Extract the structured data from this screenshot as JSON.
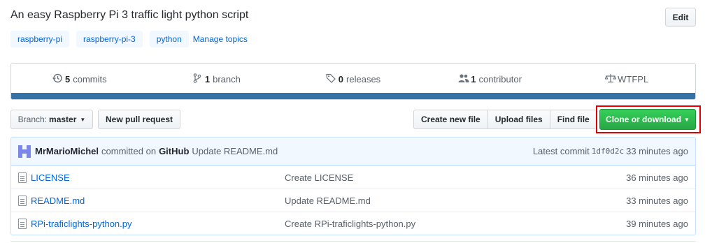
{
  "repo": {
    "description": "An easy Raspberry Pi 3 traffic light python script",
    "edit_label": "Edit",
    "topics": [
      "raspberry-pi",
      "raspberry-pi-3",
      "python"
    ],
    "manage_topics_label": "Manage topics"
  },
  "summary": {
    "commits": {
      "count": "5",
      "label": "commits",
      "icon": "history-icon"
    },
    "branches": {
      "count": "1",
      "label": "branch",
      "icon": "git-branch-icon"
    },
    "releases": {
      "count": "0",
      "label": "releases",
      "icon": "tag-icon"
    },
    "contributors": {
      "count": "1",
      "label": "contributor",
      "icon": "people-icon"
    },
    "license": {
      "label": "WTFPL",
      "icon": "law-icon"
    },
    "language_bar_color": "#3572a5"
  },
  "toolbar": {
    "branch_prefix": "Branch:",
    "branch_name": "master",
    "new_pr_label": "New pull request",
    "create_file_label": "Create new file",
    "upload_files_label": "Upload files",
    "find_file_label": "Find file",
    "clone_label": "Clone or download",
    "clone_highlight_color": "#e00000"
  },
  "commit": {
    "author": "MrMarioMichel",
    "action_text": "committed on",
    "org": "GitHub",
    "message": "Update README.md",
    "latest_label": "Latest commit",
    "sha": "1df0d2c",
    "age": "33 minutes ago"
  },
  "files": [
    {
      "name": "LICENSE",
      "message": "Create LICENSE",
      "age": "36 minutes ago"
    },
    {
      "name": "README.md",
      "message": "Update README.md",
      "age": "33 minutes ago"
    },
    {
      "name": "RPi-traficlights-python.py",
      "message": "Create RPi-traficlights-python.py",
      "age": "39 minutes ago"
    }
  ]
}
